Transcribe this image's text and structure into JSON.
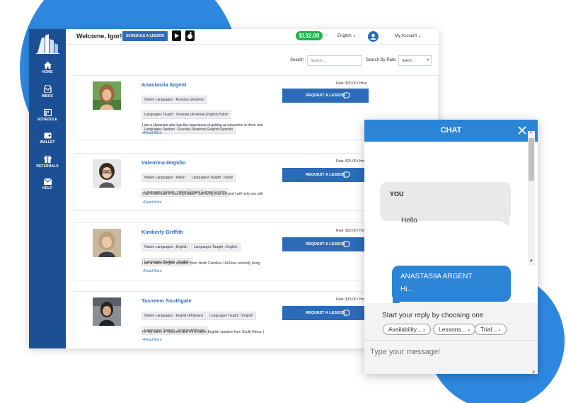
{
  "colors": {
    "brand_blue": "#2c6bb8",
    "sidebar": "#1d4f94",
    "chat_blue": "#2c84d6",
    "balance_green": "#24b24a"
  },
  "sidebar": {
    "logo_icon": "building-logo-icon",
    "items": [
      {
        "label": "HOME",
        "icon": "home-icon"
      },
      {
        "label": "INBOX",
        "icon": "inbox-icon"
      },
      {
        "label": "SCHEDULE",
        "icon": "schedule-icon"
      },
      {
        "label": "WALLET",
        "icon": "wallet-icon"
      },
      {
        "label": "REFERRALS",
        "icon": "gift-icon"
      },
      {
        "label": "HELP",
        "icon": "envelope-icon"
      }
    ]
  },
  "topbar": {
    "welcome": "Welcome, Igor!",
    "schedule_button": "SCHEDULE A LESSON",
    "balance": "$132.00",
    "language": "English",
    "account": "My Account"
  },
  "search": {
    "label": "Search :",
    "placeholder": "Search....",
    "rate_label": "Search By Rate:",
    "rate_value": "Select"
  },
  "teachers": [
    {
      "name": "Anastasiia Argent",
      "rate": "Rate: $20.00 / Hour",
      "chips": [
        "Native Languages : Russian,Ukrainian",
        "Languages Taught : Russian,Ukrainian,English,Polish",
        "Languages Spoken : Russian,Ukrainian,English,Spanish"
      ],
      "bio": "I am a Ukrainian who has the experience of getting an education in three and",
      "read_more": "+Read More",
      "button": "REQUEST A LESSON"
    },
    {
      "name": "Valentina Degidio",
      "rate": "Rate: $25.00 / Hou",
      "chips": [
        "Native Languages : Italian",
        "Languages Taught : Italian",
        "Languages Spoken : Italian,English,German,French"
      ],
      "bio": "Ciao! Interested in learning Italian? Just bring your will and I will help you with",
      "read_more": "+Read More",
      "button": "REQUEST A LESSON"
    },
    {
      "name": "Kimberly Griffith",
      "rate": "Rate: $20.00 / Hou",
      "chips": [
        "Native Languages : English",
        "Languages Taught : English",
        "Languages Spoken : English"
      ],
      "bio": "I am a native English speaker, from North Carolina, USA but currently living",
      "read_more": "+Read More",
      "button": "REQUEST A LESSON"
    },
    {
      "name": "Tasneem Southgate",
      "rate": "Rate: $15.00 / Hou",
      "chips": [
        "Native Languages : English,Afrikaans",
        "Languages Taught : English",
        "Languages Spoken : English,Afrikaans"
      ],
      "bio": "Hi! My name is Tasneem and I'm a native English speaker from South Africa. I",
      "read_more": "+Read More",
      "button": "REQUEST A LESSON"
    }
  ],
  "chat": {
    "title": "CHAT",
    "you_label": "YOU",
    "you_message": "Hello",
    "them_label": "ANASTASIIA ARGENT",
    "them_message": "Hi...",
    "reply_prompt": "Start your reply by choosing one",
    "quick_replies": [
      "Availability... ›",
      "Lessons... ›",
      "Trial... ›"
    ],
    "input_placeholder": "Type your message!"
  }
}
